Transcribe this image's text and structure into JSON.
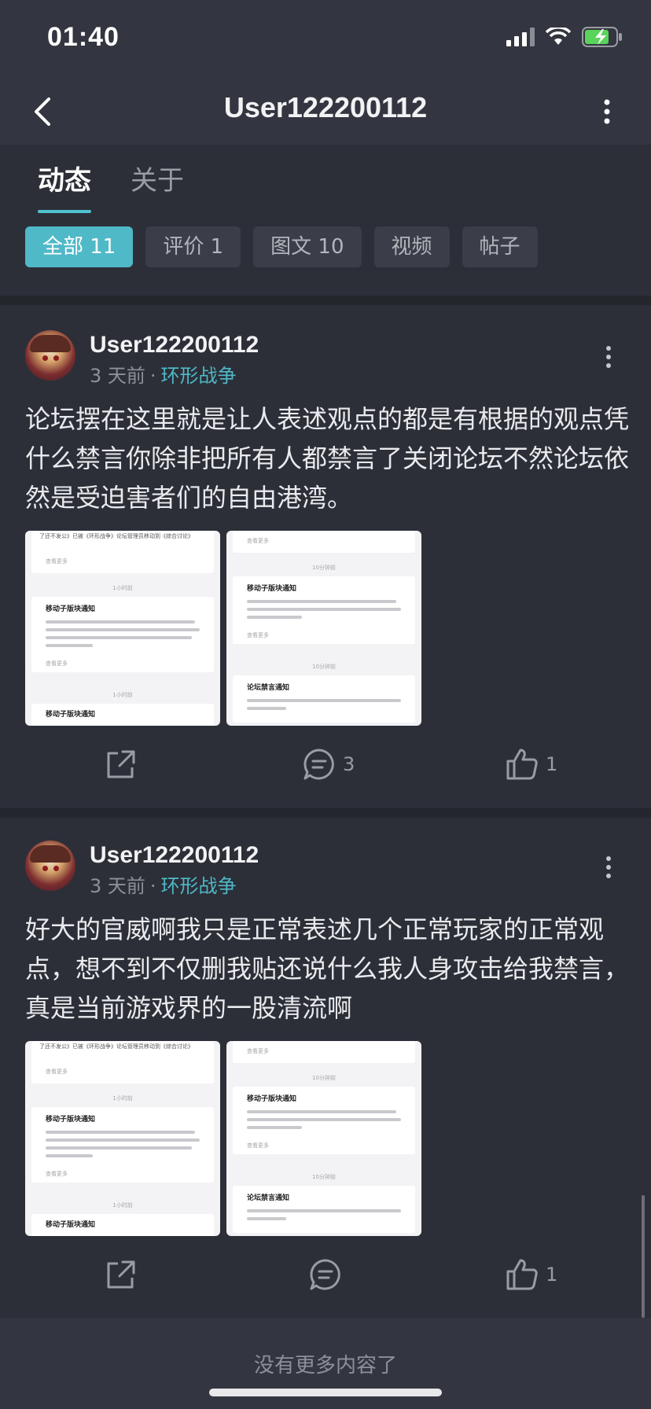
{
  "status_bar": {
    "time": "01:40"
  },
  "nav": {
    "title": "User122200112"
  },
  "tabs": [
    {
      "label": "动态",
      "active": true
    },
    {
      "label": "关于",
      "active": false
    }
  ],
  "filters": [
    {
      "label": "全部 11",
      "active": true
    },
    {
      "label": "评价 1",
      "active": false
    },
    {
      "label": "图文 10",
      "active": false
    },
    {
      "label": "视频",
      "active": false
    },
    {
      "label": "帖子",
      "active": false
    }
  ],
  "posts": [
    {
      "author": "User122200112",
      "time": "3 天前",
      "separator": "·",
      "game": "环形战争",
      "text": "论坛摆在这里就是让人表述观点的都是有根据的观点凭什么禁言你除非把所有人都禁言了关闭论坛不然论坛依然是受迫害者们的自由港湾。",
      "comment_count": "3",
      "like_count": "1"
    },
    {
      "author": "User122200112",
      "time": "3 天前",
      "separator": "·",
      "game": "环形战争",
      "text": "好大的官威啊我只是正常表述几个正常玩家的正常观点，想不到不仅删我贴还说什么我人身攻击给我禁言，真是当前游戏界的一股清流啊",
      "comment_count": "",
      "like_count": "1"
    }
  ],
  "thumb_left": {
    "top_line": "了还不发公》已被《环形战争》论坛管理员移动到《综合讨论》",
    "more": "查看更多",
    "time": "1小时前",
    "title": "移动子版块通知",
    "title2": "移动子版块通知"
  },
  "thumb_right": {
    "more": "查看更多",
    "time": "10分钟前",
    "title": "移动子版块通知",
    "time2": "10分钟前",
    "title2": "论坛禁言通知"
  },
  "footer": {
    "text": "没有更多内容了"
  },
  "colors": {
    "accent": "#4fb9c8",
    "background": "#2c2f38",
    "bar": "#333640"
  }
}
